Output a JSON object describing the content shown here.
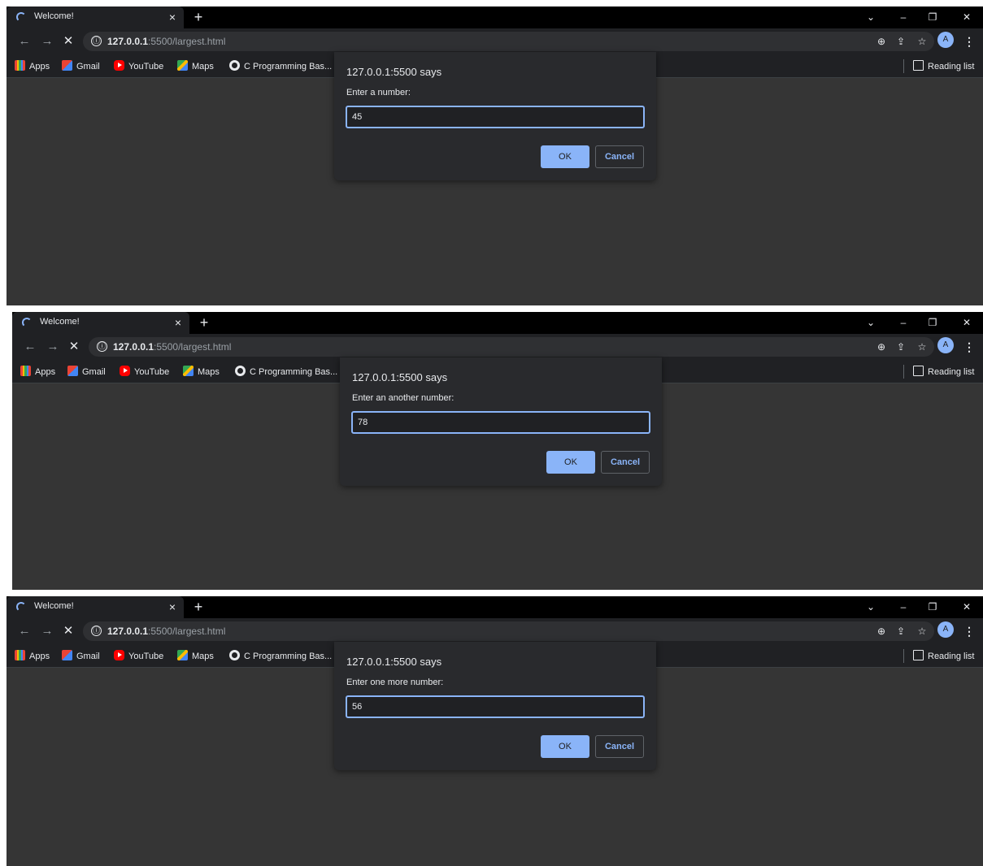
{
  "browser": {
    "tab_title": "Welcome!",
    "tab_close": "×",
    "new_tab": "+",
    "url_host": "127.0.0.1",
    "url_rest": ":5500/largest.html",
    "info_glyph": "ⓘ",
    "profile_initial": "A",
    "window_controls": {
      "tabsearch": "⌄",
      "minimize": "–",
      "restore": "❐",
      "close": "✕"
    },
    "nav": {
      "back": "←",
      "forward": "→",
      "stop": "✕"
    },
    "omni_icons": {
      "zoom": "⊕",
      "share": "⇪",
      "bookmark": "☆",
      "menu": "⋮"
    },
    "bookmarks": [
      {
        "label": "Apps",
        "icon": "apps-grid-icon"
      },
      {
        "label": "Gmail",
        "icon": "gmail-icon"
      },
      {
        "label": "YouTube",
        "icon": "youtube-icon"
      },
      {
        "label": "Maps",
        "icon": "maps-icon"
      },
      {
        "label": "C Programming Bas...",
        "icon": "globe-icon"
      }
    ],
    "reading_list": "Reading list"
  },
  "dialogs": [
    {
      "title": "127.0.0.1:5500 says",
      "message": "Enter a number:",
      "value": "45",
      "ok": "OK",
      "cancel": "Cancel"
    },
    {
      "title": "127.0.0.1:5500 says",
      "message": "Enter an another number:",
      "value": "78",
      "ok": "OK",
      "cancel": "Cancel"
    },
    {
      "title": "127.0.0.1:5500 says",
      "message": "Enter one more number:",
      "value": "56",
      "ok": "OK",
      "cancel": "Cancel"
    }
  ],
  "colors": {
    "accent": "#8ab4f8",
    "page_bg": "#353535",
    "chrome_bg": "#202124",
    "dialog_bg": "#292a2d"
  }
}
